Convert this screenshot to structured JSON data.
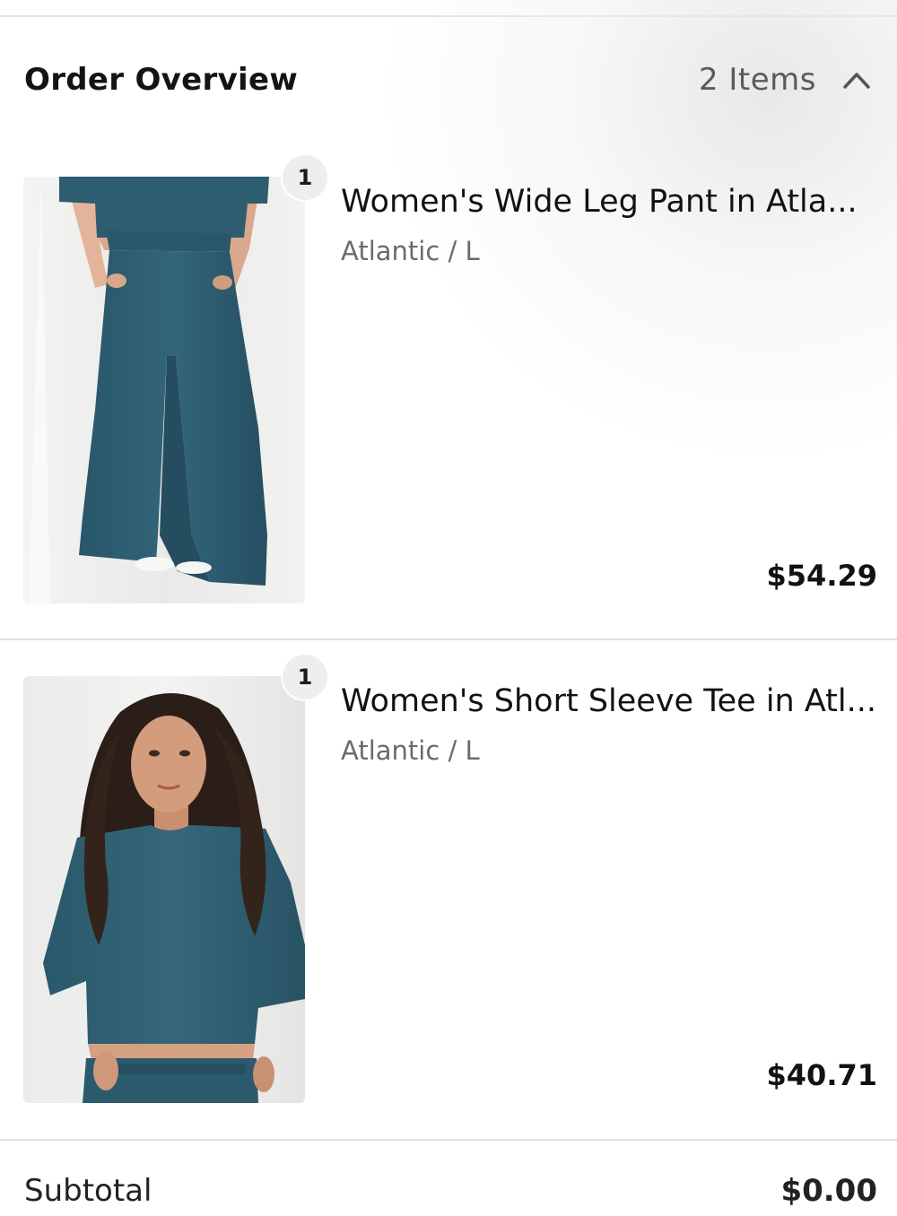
{
  "order_overview": {
    "title": "Order Overview",
    "item_count_label": "2 Items",
    "toggle_icon": "chevron-up-icon"
  },
  "items": [
    {
      "quantity": "1",
      "name": "Women's Wide Leg Pant in Atla...",
      "variant": "Atlantic / L",
      "price": "$54.29",
      "image": "wide-leg-pant-photo"
    },
    {
      "quantity": "1",
      "name": "Women's Short Sleeve Tee in Atl...",
      "variant": "Atlantic / L",
      "price": "$40.71",
      "image": "short-sleeve-tee-photo"
    }
  ],
  "subtotal": {
    "label": "Subtotal",
    "value": "$0.00"
  },
  "colors": {
    "fabric": "#2f5f72",
    "badge_bg": "#eeeeee",
    "divider": "#e0e0e0"
  }
}
